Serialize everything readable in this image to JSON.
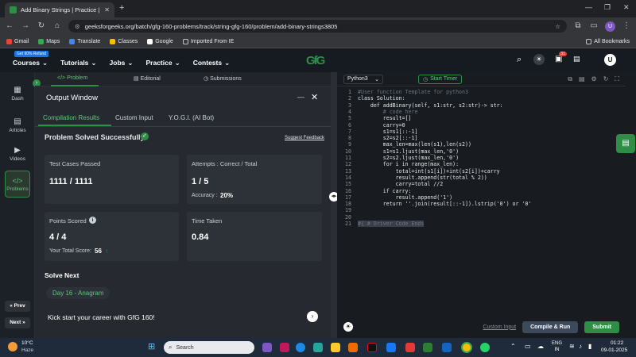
{
  "browser": {
    "tab_title": "Add Binary Strings | Practice | G",
    "url": "geeksforgeeks.org/batch/gfg-160-problems/track/string-gfg-160/problem/add-binary-strings3805",
    "profile_initial": "U",
    "bookmarks": [
      "Gmail",
      "Maps",
      "Translate",
      "Classes",
      "Google",
      "Imported From IE"
    ],
    "all_bookmarks": "All Bookmarks"
  },
  "header": {
    "logo": "GfG",
    "refund_badge": "Get 90% Refund",
    "nav": [
      "Courses",
      "Tutorials",
      "Jobs",
      "Practice",
      "Contests"
    ],
    "notif_count": "31",
    "avatar_initial": "U"
  },
  "sidebar": {
    "items": [
      "Dash",
      "Articles",
      "Videos",
      "Problems"
    ],
    "prev": "« Prev",
    "next": "Next »"
  },
  "panel_tabs": [
    "Problem",
    "Editorial",
    "Submissions"
  ],
  "output": {
    "title": "Output Window",
    "tabs": [
      "Compilation Results",
      "Custom Input",
      "Y.O.G.I. (AI Bot)"
    ],
    "status": "Problem Solved Successfully",
    "suggest": "Suggest Feedback",
    "tests_label": "Test Cases Passed",
    "tests_value": "1111 / 1111",
    "attempts_label": "Attempts : Correct / Total",
    "attempts_value": "1 / 5",
    "accuracy_label": "Accuracy :",
    "accuracy_value": "20%",
    "points_label": "Points Scored",
    "points_value": "4 / 4",
    "total_label": "Your Total Score:",
    "total_value": "56",
    "time_label": "Time Taken",
    "time_value": "0.84",
    "solve_next": "Solve Next",
    "next_problem": "Day 16 - Anagram",
    "promo": "Kick start your career with GfG 160!"
  },
  "editor": {
    "language": "Python3",
    "timer": "Start Timer",
    "custom_input": "Custom Input",
    "compile": "Compile & Run",
    "submit": "Submit",
    "lines": [
      "#User function Template for python3",
      "class Solution:",
      "    def addBinary(self, s1:str, s2:str)-> str:",
      "        # code here",
      "        result=[]",
      "        carry=0",
      "        s1=s1[::-1]",
      "        s2=s2[::-1]",
      "        max_len=max(len(s1),len(s2))",
      "        s1=s1.ljust(max_len,'0')",
      "        s2=s2.ljust(max_len,'0')",
      "        for i in range(max_len):",
      "            total=int(s1[i])+int(s2[i])+carry",
      "            result.append(str(total % 2))",
      "            carry=total //2",
      "        if carry:",
      "            result.append('1')",
      "        return ''.join(result[::-1]).lstrip('0') or '0'",
      "",
      "",
      "#{ # Driver Code Ends"
    ]
  },
  "taskbar": {
    "weather_temp": "10°C",
    "weather_desc": "Haze",
    "search": "Search",
    "lang1": "ENG",
    "lang2": "IN",
    "time": "01:22",
    "date": "09-01-2025"
  }
}
